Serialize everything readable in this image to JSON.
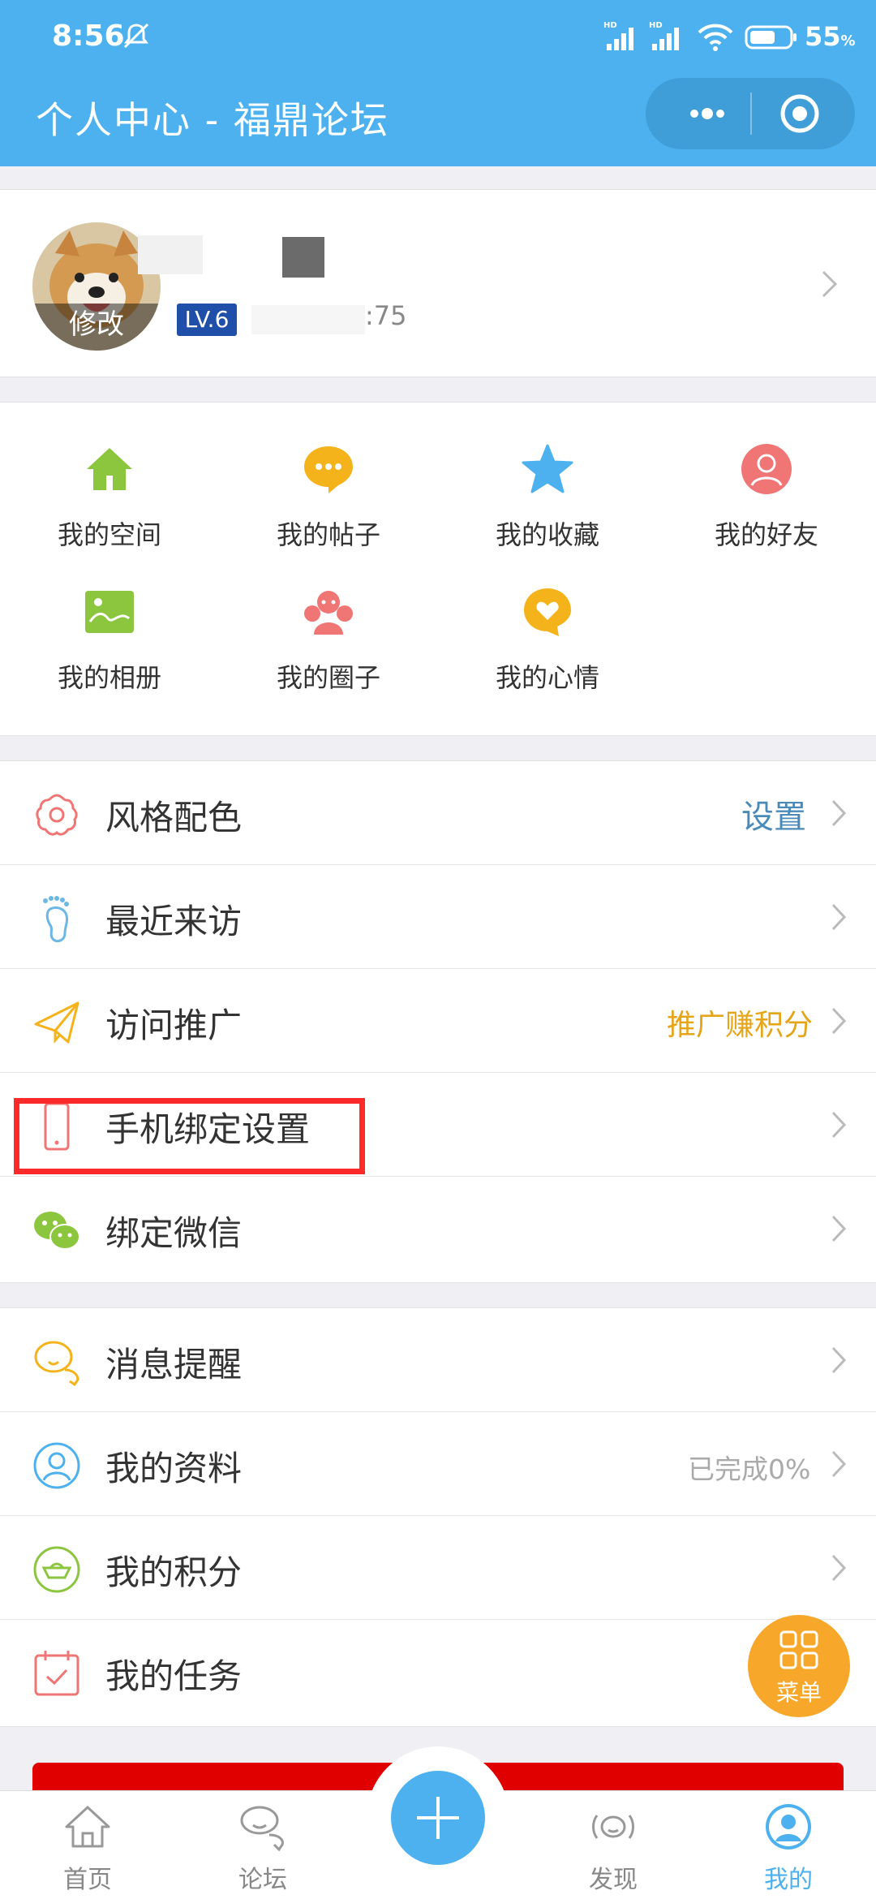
{
  "status": {
    "time": "8:56",
    "battery": "55",
    "battery_unit": "%"
  },
  "header": {
    "title": "个人中心 - 福鼎论坛"
  },
  "profile": {
    "avatar_edit": "修改",
    "level": "LV.6",
    "points_text": ":75"
  },
  "grid": [
    {
      "label": "我的空间",
      "icon": "home-icon",
      "color": "#8cc63f"
    },
    {
      "label": "我的帖子",
      "icon": "chat-bubble-icon",
      "color": "#f5b31b"
    },
    {
      "label": "我的收藏",
      "icon": "star-icon",
      "color": "#4db1ef"
    },
    {
      "label": "我的好友",
      "icon": "user-circle-icon",
      "color": "#f06a6a"
    },
    {
      "label": "我的相册",
      "icon": "photo-icon",
      "color": "#8cc63f"
    },
    {
      "label": "我的圈子",
      "icon": "group-icon",
      "color": "#f06a6a"
    },
    {
      "label": "我的心情",
      "icon": "heart-bubble-icon",
      "color": "#f5b31b"
    }
  ],
  "list1": [
    {
      "label": "风格配色",
      "extra": "设置",
      "extra_color": "#4a8ab8"
    },
    {
      "label": "最近来访",
      "extra": ""
    },
    {
      "label": "访问推广",
      "extra": "推广赚积分",
      "extra_color": "#e6a417"
    },
    {
      "label": "手机绑定设置",
      "extra": ""
    },
    {
      "label": "绑定微信",
      "extra": ""
    }
  ],
  "list2": [
    {
      "label": "消息提醒",
      "extra": ""
    },
    {
      "label": "我的资料",
      "extra": "已完成0%",
      "extra_color": "#aaaaaa"
    },
    {
      "label": "我的积分",
      "extra": ""
    },
    {
      "label": "我的任务",
      "extra": ""
    }
  ],
  "fab": {
    "label": "菜单"
  },
  "tabs": [
    {
      "label": "首页"
    },
    {
      "label": "论坛"
    },
    {
      "label": "发现"
    },
    {
      "label": "我的"
    }
  ],
  "colors": {
    "primary": "#4db1ef",
    "highlight": "#ff2b2b",
    "fab": "#f7a82a"
  }
}
